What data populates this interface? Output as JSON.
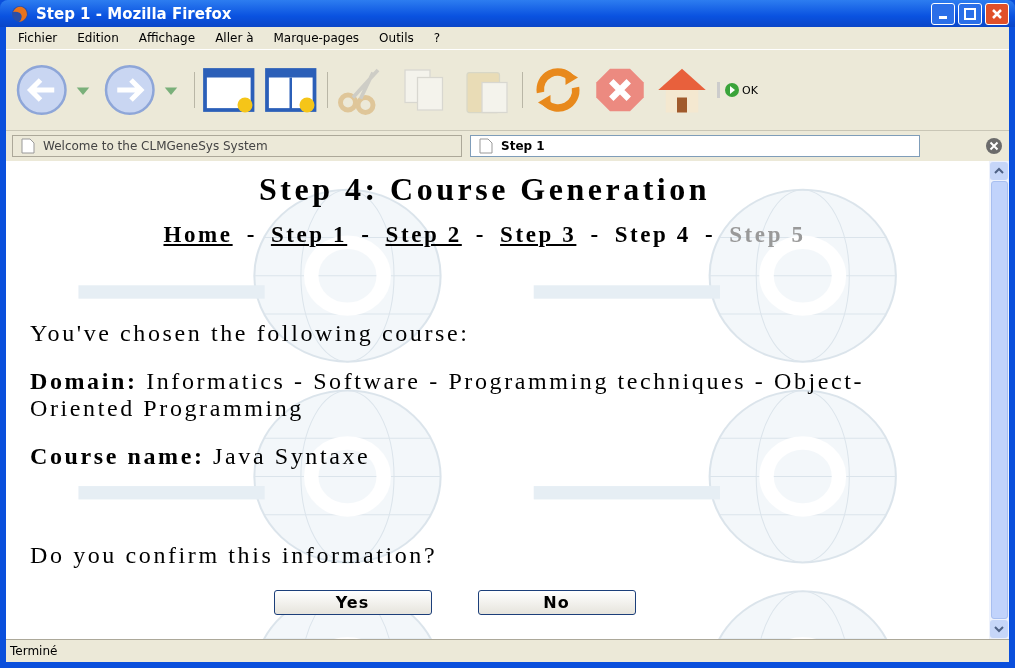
{
  "window": {
    "title": "Step 1 - Mozilla Firefox"
  },
  "menu": [
    "Fichier",
    "Edition",
    "Affichage",
    "Aller à",
    "Marque-pages",
    "Outils",
    "?"
  ],
  "toolbar": {
    "go_label": "OK"
  },
  "tabs": [
    {
      "label": "Welcome to the CLMGeneSys System",
      "selected": false
    },
    {
      "label": "Step 1",
      "selected": true
    }
  ],
  "page": {
    "heading": "Step 4: Course Generation",
    "nav": [
      {
        "label": "Home",
        "selected": false,
        "disabled": false
      },
      {
        "label": "Step 1",
        "selected": false,
        "disabled": false
      },
      {
        "label": "Step 2",
        "selected": false,
        "disabled": false
      },
      {
        "label": "Step 3",
        "selected": false,
        "disabled": false
      },
      {
        "label": "Step 4",
        "selected": true,
        "disabled": false
      },
      {
        "label": "Step 5",
        "selected": false,
        "disabled": true
      }
    ],
    "separator": "-",
    "intro": "You've chosen the following course:",
    "domain": "**Domain:** Informatics - Software - Programming techniques - Object-Oriented Programming",
    "course": "**Course name:** Java Syntaxe",
    "question": "Do you confirm this information?",
    "buttons": [
      "Yes",
      "No"
    ]
  },
  "status_bar": "Terminé"
}
